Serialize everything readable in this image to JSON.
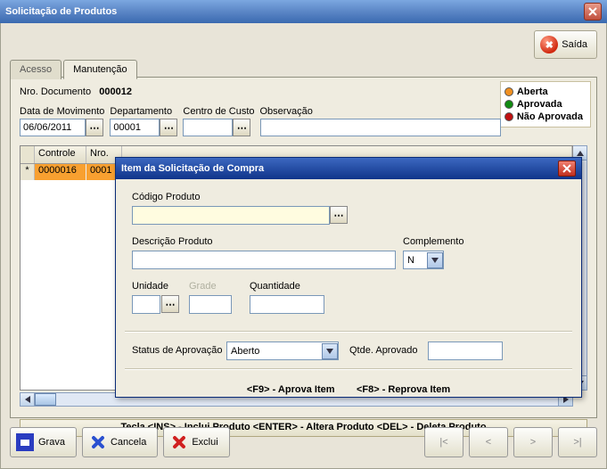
{
  "window": {
    "title": "Solicitação de Produtos"
  },
  "exit": {
    "label": "Saída"
  },
  "tabs": {
    "acesso": "Acesso",
    "manutencao": "Manutenção"
  },
  "legend": {
    "aberta": "Aberta",
    "aprovada": "Aprovada",
    "nao_aprovada": "Não Aprovada"
  },
  "doc": {
    "label": "Nro. Documento",
    "value": "000012"
  },
  "fields": {
    "data_mov_label": "Data de Movimento",
    "data_mov_value": "06/06/2011",
    "depto_label": "Departamento",
    "depto_value": "00001",
    "cc_label": "Centro de Custo",
    "cc_value": "",
    "obs_label": "Observação",
    "obs_value": ""
  },
  "grid": {
    "col_controle": "Controle",
    "col_nro": "Nro.",
    "row0_controle": "0000016",
    "row0_nro": "0001"
  },
  "hint_main": "Tecla <INS> - Inclui Produto   <ENTER> - Altera Produto   <DEL> - Deleta Produto",
  "buttons": {
    "grava": "Grava",
    "cancela": "Cancela",
    "exclui": "Exclui",
    "nav_first": "|<",
    "nav_prev": "<",
    "nav_next": ">",
    "nav_last": ">|"
  },
  "modal": {
    "title": "Item da Solicitação de Compra",
    "codigo_label": "Código Produto",
    "codigo_value": "",
    "descricao_label": "Descrição Produto",
    "descricao_value": "",
    "complemento_label": "Complemento",
    "complemento_value": "N",
    "unidade_label": "Unidade",
    "unidade_value": "",
    "grade_label": "Grade",
    "quantidade_label": "Quantidade",
    "quantidade_value": "",
    "status_label": "Status de Aprovação",
    "status_value": "Aberto",
    "qtde_aprov_label": "Qtde. Aprovado",
    "qtde_aprov_value": "",
    "hint_f9": "<F9> - Aprova Item",
    "hint_f8": "<F8> - Reprova Item"
  }
}
